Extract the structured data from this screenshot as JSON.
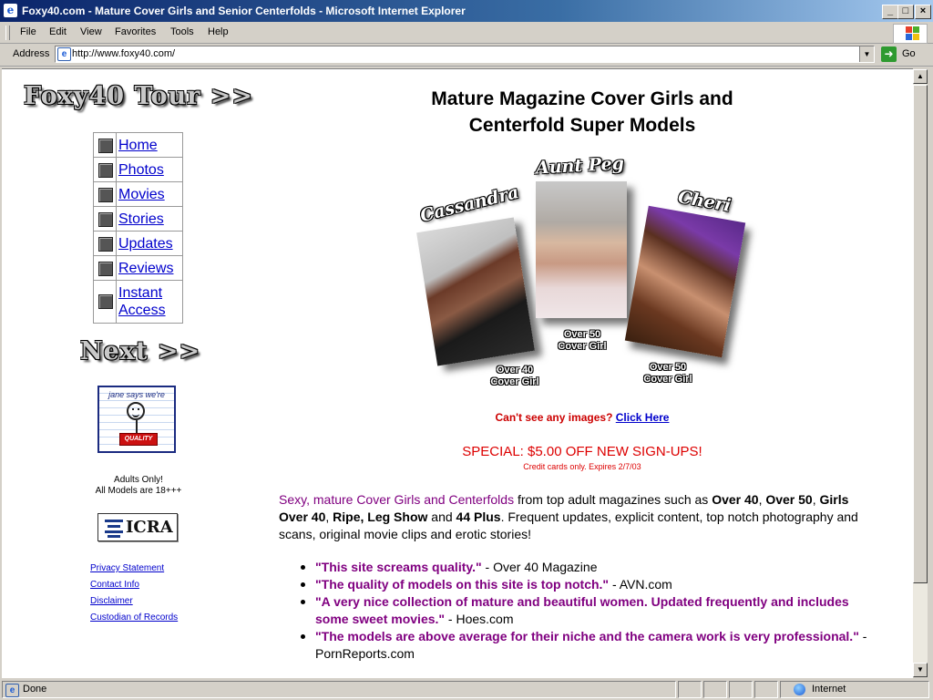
{
  "window": {
    "title": "Foxy40.com - Mature Cover Girls and Senior Centerfolds - Microsoft Internet Explorer",
    "minimize": "_",
    "maximize": "□",
    "close": "×"
  },
  "menu": [
    "File",
    "Edit",
    "View",
    "Favorites",
    "Tools",
    "Help"
  ],
  "address": {
    "label": "Address",
    "url": "http://www.foxy40.com/",
    "go_label": "Go"
  },
  "status": {
    "text": "Done",
    "zone": "Internet"
  },
  "sidebar": {
    "tour_title": "Foxy40 Tour >>",
    "nav": [
      {
        "label": "Home"
      },
      {
        "label": "Photos"
      },
      {
        "label": "Movies"
      },
      {
        "label": "Stories"
      },
      {
        "label": "Updates"
      },
      {
        "label": "Reviews"
      },
      {
        "label_line1": "Instant",
        "label_line2": "Access"
      }
    ],
    "next_title": "Next >>",
    "badge_text": "jane says we're",
    "badge_sign": "QUALITY",
    "adults_line1": "Adults Only!",
    "adults_line2": "All Models are 18+++",
    "icra_label": "ICRA",
    "footer_links": [
      "Privacy Statement",
      "Contact Info",
      "Disclaimer",
      "Custodian of Records"
    ]
  },
  "main": {
    "heading_line1": "Mature Magazine Cover Girls and",
    "heading_line2": "Centerfold Super Models",
    "models": [
      {
        "name": "Cassandra",
        "caption_line1": "Over 40",
        "caption_line2": "Cover Girl"
      },
      {
        "name": "Aunt Peg",
        "caption_line1": "Over 50",
        "caption_line2": "Cover Girl"
      },
      {
        "name": "Cheri",
        "caption_line1": "Over 50",
        "caption_line2": "Cover Girl"
      }
    ],
    "cant_see": "Can't see any images?",
    "click_here": "Click Here",
    "special": "SPECIAL: $5.00 OFF NEW SIGN-UPS!",
    "special_sub": "Credit cards only. Expires 2/7/03",
    "intro": {
      "lead": "Sexy, mature Cover Girls and Centerfolds",
      "t1": " from top adult magazines such as ",
      "b1": "Over 40",
      "t2": ", ",
      "b2": "Over 50",
      "t3": ", ",
      "b3": "Girls Over 40",
      "t4": ", ",
      "b4": "Ripe, Leg Show",
      "t5": " and ",
      "b5": "44 Plus",
      "t6": ". Frequent updates, explicit content, top notch photography and scans, original movie clips and erotic stories!"
    },
    "quotes": [
      {
        "quote": "\"This site screams quality.\"",
        "source": " - Over 40 Magazine"
      },
      {
        "quote": "\"The quality of models on this site is top notch.\"",
        "source": " - AVN.com"
      },
      {
        "quote": "\"A very nice collection of mature and beautiful women. Updated frequently and includes some sweet movies.\"",
        "source": " - Hoes.com"
      },
      {
        "quote": "\"The models are above average for their niche and the camera work is very professional.\"",
        "source": " - PornReports.com"
      }
    ]
  }
}
